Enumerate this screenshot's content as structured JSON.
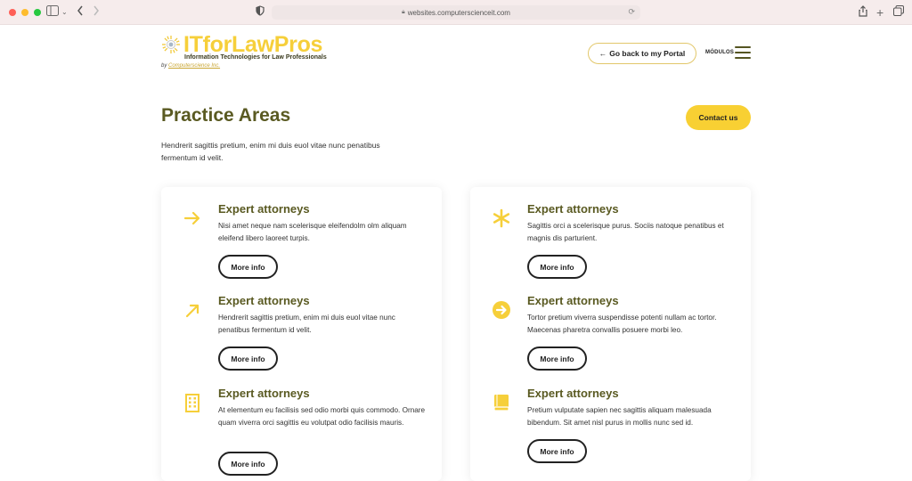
{
  "browser": {
    "url": "websites.computerscienceit.com"
  },
  "header": {
    "brand": "ITforLawPros",
    "tagline": "Information Technologies for Law Professionals",
    "byline_prefix": "by",
    "byline_link": "Computerscience Inc.",
    "portal_button": "Go back to my Portal",
    "menu_label": "MÓDULOS"
  },
  "hero": {
    "title": "Practice Areas",
    "contact_button": "Contact us",
    "intro": "Hendrerit sagittis pretium, enim mi duis euol vitae nunc penatibus fermentum id velit."
  },
  "services_left": [
    {
      "icon": "arrow-right-icon",
      "title": "Expert attorneys",
      "desc": "Nisi amet neque nam scelerisque eleifendolm olm aliquam eleifend libero laoreet turpis.",
      "button": "More info"
    },
    {
      "icon": "arrow-up-right-icon",
      "title": "Expert attorneys",
      "desc": "Hendrerit sagittis pretium, enim mi duis euol vitae nunc penatibus fermentum id velit.",
      "button": "More info"
    },
    {
      "icon": "building-icon",
      "title": "Expert attorneys",
      "desc": "At elementum eu facilisis sed odio morbi quis commodo. Ornare quam viverra orci sagittis eu volutpat odio facilisis mauris.",
      "button": "More info"
    }
  ],
  "services_right": [
    {
      "icon": "asterisk-icon",
      "title": "Expert attorneys",
      "desc": "Sagittis orci a scelerisque purus. Sociis natoque penatibus et magnis dis parturient.",
      "button": "More info"
    },
    {
      "icon": "arrow-circle-icon",
      "title": "Expert attorneys",
      "desc": "Tortor pretium viverra suspendisse potenti nullam ac tortor. Maecenas pharetra convallis posuere morbi leo.",
      "button": "More info"
    },
    {
      "icon": "book-icon",
      "title": "Expert attorneys",
      "desc": "Pretium vulputate sapien nec sagittis aliquam malesuada bibendum. Sit amet nisl purus in mollis nunc sed id.",
      "button": "More info"
    }
  ],
  "colors": {
    "accent": "#f8d033",
    "heading": "#5a5a22"
  }
}
